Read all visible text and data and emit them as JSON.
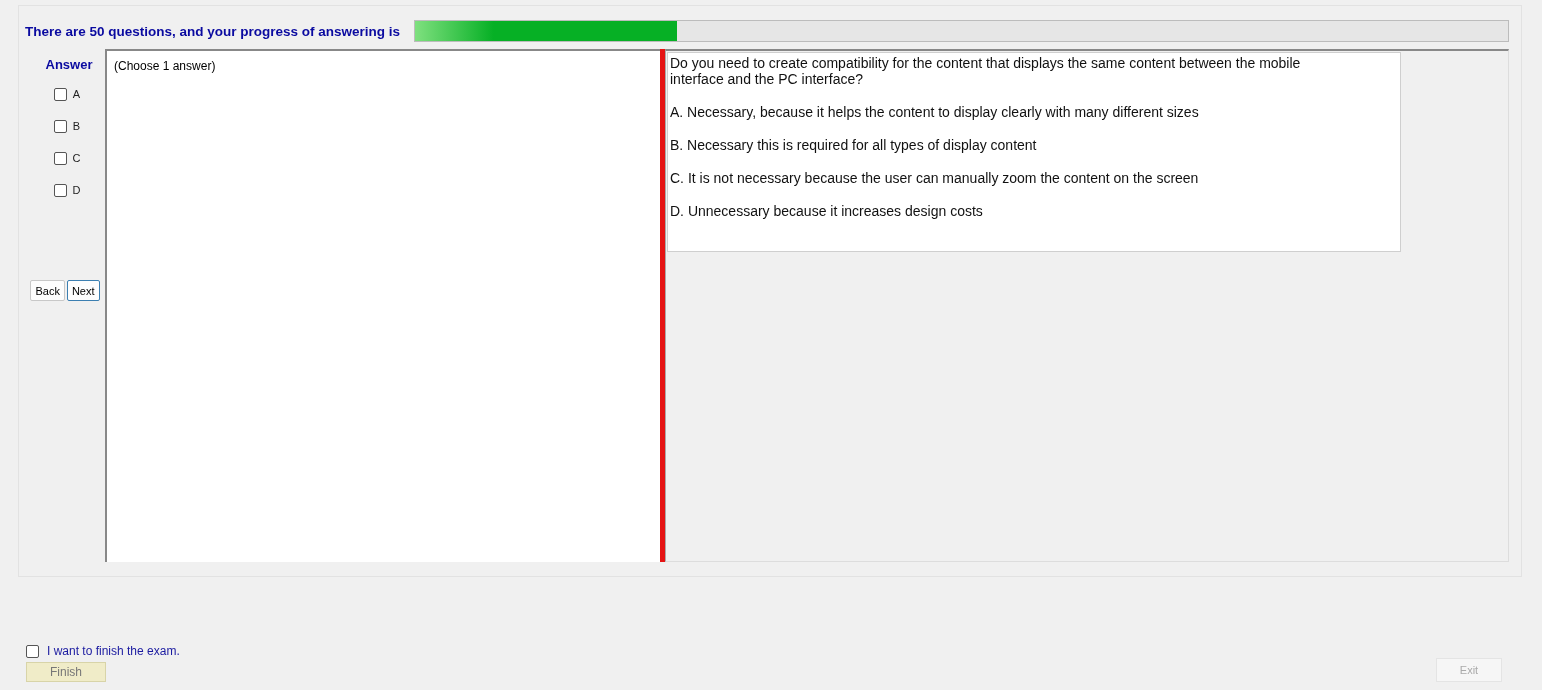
{
  "header": {
    "text": "There are 50 questions, and your progress of answering is",
    "progress": {
      "level": 0.24
    }
  },
  "answer": {
    "title": "Answer",
    "options": [
      {
        "label": "A",
        "checked": false
      },
      {
        "label": "B",
        "checked": false
      },
      {
        "label": "C",
        "checked": false
      },
      {
        "label": "D",
        "checked": false
      }
    ],
    "buttons": [
      {
        "label": "Back",
        "selected": false
      },
      {
        "label": "Next",
        "selected": true
      }
    ]
  },
  "instruction": "(Choose 1 answer)",
  "question": {
    "text": "Do you need to create compatibility for the content that displays the same content between the mobile interface and the PC interface?",
    "choices": [
      "A.  Necessary, because it helps the content to display clearly with many different sizes",
      "B.  Necessary this is required for all types of display content",
      "C.  It is not necessary because the user can manually zoom the content on the screen",
      "D.  Unnecessary because it increases design costs"
    ]
  },
  "finish": {
    "label": "I want to finish the exam.",
    "checked": false,
    "button": "Finish",
    "disabled": true
  },
  "exit": {
    "label": "Exit",
    "disabled": true
  }
}
